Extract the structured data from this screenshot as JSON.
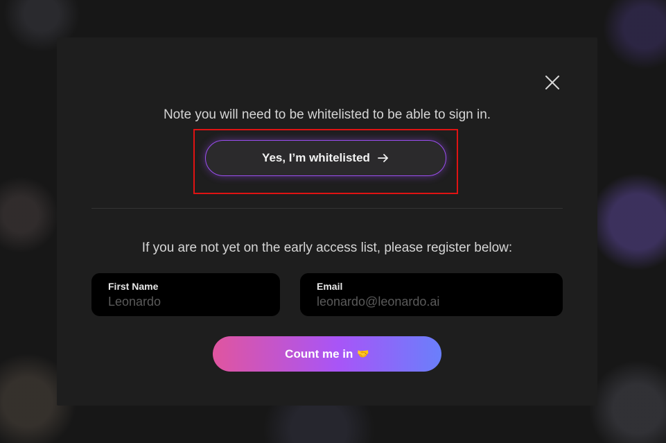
{
  "modal": {
    "note": "Note you will need to be whitelisted to be able to sign in.",
    "whitelist_button": "Yes, I’m whitelisted",
    "register_note": "If you are not yet on the early access list, please register below:",
    "first_name": {
      "label": "First Name",
      "placeholder": "Leonardo",
      "value": ""
    },
    "email": {
      "label": "Email",
      "placeholder": "leonardo@leonardo.ai",
      "value": ""
    },
    "submit_button": "Count me in",
    "submit_emoji": "🤝"
  },
  "icons": {
    "close": "close-icon",
    "arrow": "arrow-right-icon",
    "handshake": "handshake-emoji"
  },
  "colors": {
    "accent_purple": "#9b4ef0",
    "gradient_start": "#e0559f",
    "gradient_mid": "#a855f7",
    "gradient_end": "#6a7ffb",
    "highlight_red": "#e01313"
  }
}
